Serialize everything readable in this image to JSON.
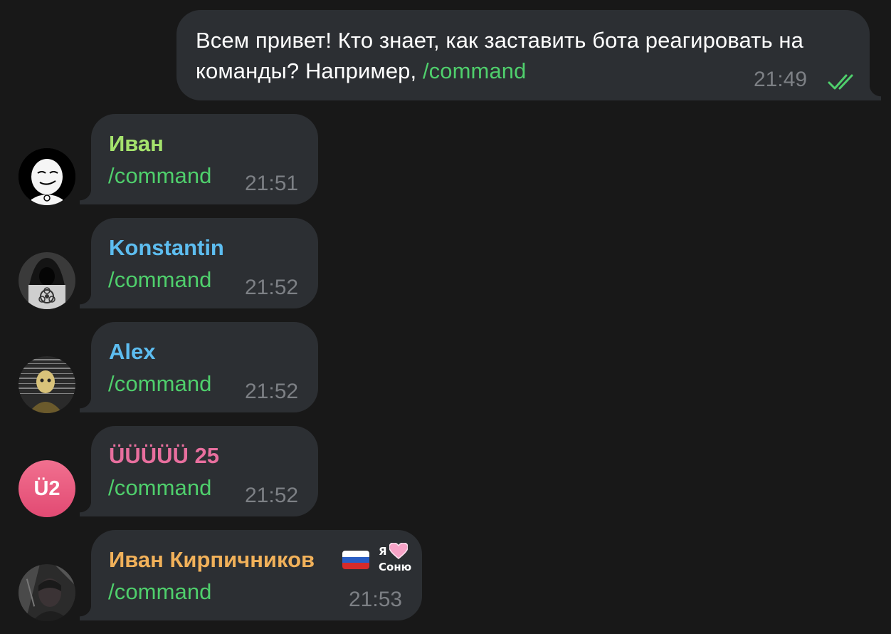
{
  "outgoing": {
    "text_line1": "Всем привет! Кто знает, как заставить бота реагировать на",
    "text_line2_prefix": "команды? Например, ",
    "command": "/command",
    "time": "21:49",
    "status_icon": "double-check-icon"
  },
  "messages": [
    {
      "sender": "Иван",
      "sender_color": "#a5e36d",
      "text": "/command",
      "time": "21:51",
      "avatar": "meme-face-avatar"
    },
    {
      "sender": "Konstantin",
      "sender_color": "#5dbdf0",
      "text": "/command",
      "time": "21:52",
      "avatar": "hooded-figure-biohazard-avatar"
    },
    {
      "sender": "Alex",
      "sender_color": "#5dbdf0",
      "text": "/command",
      "time": "21:52",
      "avatar": "glitch-portrait-avatar"
    },
    {
      "sender": "ÜÜÜÜÜ 25",
      "sender_color": "#e86f9e",
      "text": "/command",
      "time": "21:52",
      "avatar_initials": "Ü2",
      "avatar_color": "#e8577f"
    },
    {
      "sender": "Иван Кирпичников",
      "sender_color": "#f1b15a",
      "text": "/command",
      "time": "21:53",
      "avatar": "dark-portrait-avatar",
      "emoji": "russia-flag-icon",
      "sticker_line1": "Я",
      "sticker_line2": "Соню",
      "sticker_icon": "heart-icon"
    }
  ],
  "colors": {
    "background": "#181818",
    "bubble": "#2c2f33",
    "command": "#4fcf6c",
    "time": "#7d8085"
  }
}
